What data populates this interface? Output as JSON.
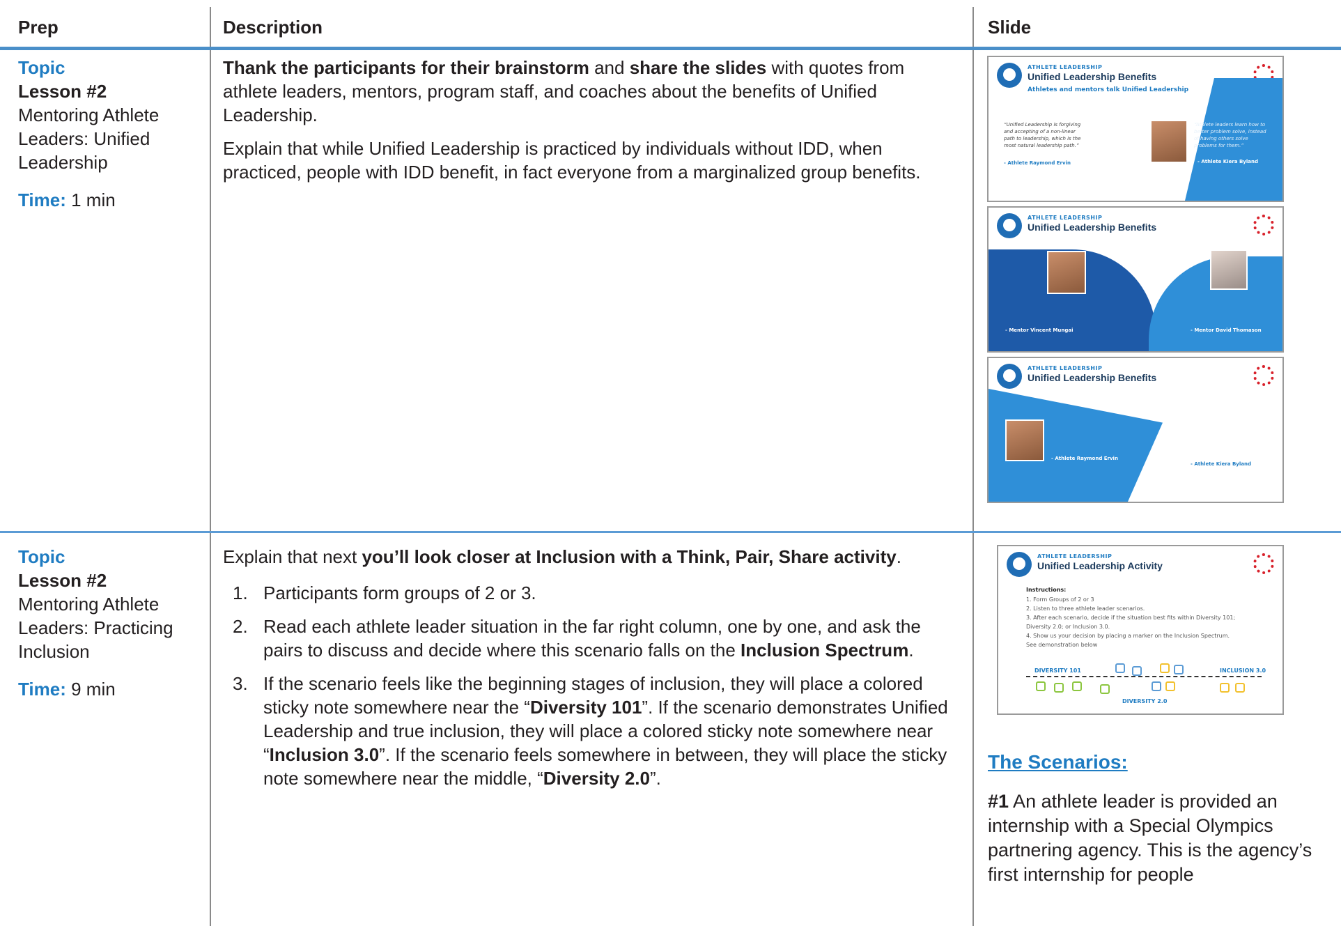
{
  "headers": {
    "prep": "Prep",
    "description": "Description",
    "slide": "Slide"
  },
  "row1": {
    "topic": "Topic",
    "lesson": "Lesson #2",
    "lesson_name_lines": [
      "Mentoring Athlete",
      "Leaders: Unified",
      "Leadership"
    ],
    "time_label": "Time:",
    "time_value": "1 min",
    "para1_bold1": "Thank the participants for their brainstorm",
    "para1_mid": " and ",
    "para1_bold2": "share the slides",
    "para1_rest": " with quotes from athlete leaders, mentors, program staff, and coaches about the benefits of Unified Leadership.",
    "para2": "Explain that while Unified Leadership is practiced by individuals without IDD, when practiced, people with IDD benefit, in fact everyone from a marginalized group benefits.",
    "slides": [
      {
        "kicker": "ATHLETE LEADERSHIP",
        "title": "Unified Leadership Benefits",
        "subtitle": "Athletes and mentors talk Unified Leadership",
        "quote_left": "“Unified Leadership is forgiving and accepting of a non-linear path to leadership, which is the most natural leadership path.”",
        "attr_left": "- Athlete Raymond Ervin",
        "quote_right": "“Athlete leaders learn how to better problem solve, instead of having others solve problems for them.”",
        "attr_right": "- Athlete Kiera Byland"
      },
      {
        "kicker": "ATHLETE LEADERSHIP",
        "title": "Unified Leadership Benefits",
        "attr_left": "- Mentor Vincent Mungai",
        "attr_right": "- Mentor David Thomason"
      },
      {
        "kicker": "ATHLETE LEADERSHIP",
        "title": "Unified Leadership Benefits",
        "attr_left": "- Athlete Raymond Ervin",
        "attr_right": "- Athlete Kiera Byland"
      }
    ]
  },
  "row2": {
    "topic": "Topic",
    "lesson": "Lesson #2",
    "lesson_name_lines": [
      "Mentoring Athlete",
      "Leaders: Practicing",
      "Inclusion"
    ],
    "time_label": "Time:",
    "time_value": "9 min",
    "intro_plain": "Explain that next ",
    "intro_bold": "you’ll look closer at Inclusion with a Think, Pair, Share activity",
    "intro_end": ".",
    "steps": [
      {
        "num": "1.",
        "text": "Participants form groups of 2 or 3."
      },
      {
        "num": "2.",
        "pre": "Read each athlete leader situation in the far right column, one by one, and ask the pairs to discuss and decide where this scenario falls on the ",
        "bold": "Inclusion Spectrum",
        "post": "."
      },
      {
        "num": "3.",
        "a": "If the scenario feels like the beginning stages of inclusion, they will place a colored sticky note somewhere near the “",
        "b1": "Diversity 101",
        "c": "”. If the scenario demonstrates Unified Leadership and true inclusion, they will place a colored sticky note somewhere near “",
        "b2": "Inclusion 3.0",
        "d": "”. If the scenario feels somewhere in between, they will place the sticky note somewhere near the middle, “",
        "b3": "Diversity 2.0",
        "e": "”."
      }
    ],
    "activity_slide": {
      "kicker": "ATHLETE LEADERSHIP",
      "title": "Unified Leadership Activity",
      "instructions_label": "Instructions:",
      "instructions": [
        "1.  Form Groups of 2 or 3",
        "2.  Listen to three athlete leader scenarios.",
        "3.  After each scenario, decide if the situation best fits within Diversity 101;",
        "     Diversity 2.0; or Inclusion 3.0.",
        "4.  Show us your decision by placing a marker on the Inclusion Spectrum.",
        "     See demonstration below"
      ],
      "label_left": "DIVERSITY 101",
      "label_mid": "DIVERSITY 2.0",
      "label_right": "INCLUSION 3.0"
    },
    "scenarios_title": "The Scenarios:",
    "scenario1_num": "#1",
    "scenario1_text": " An athlete leader is provided an internship with a Special Olympics partnering agency. This is the agency’s first internship for people"
  },
  "colors": {
    "accent": "#1f7cc2",
    "rule": "#4a8fc9",
    "slide_blue": "#2f8fd8",
    "so_red": "#d8212b"
  }
}
